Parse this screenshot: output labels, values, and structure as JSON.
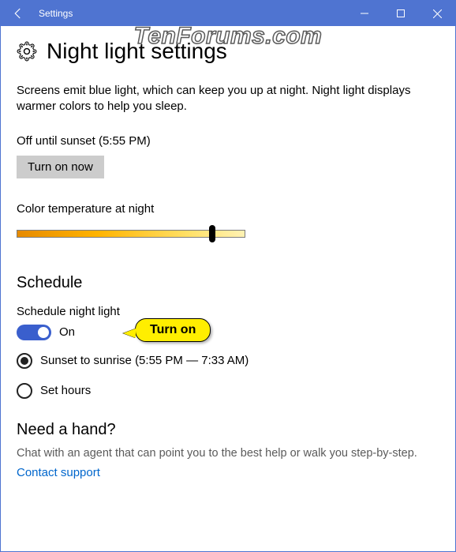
{
  "window": {
    "title": "Settings"
  },
  "page": {
    "heading": "Night light settings",
    "description": "Screens emit blue light, which can keep you up at night. Night light displays warmer colors to help you sleep.",
    "status": "Off until sunset (5:55 PM)",
    "turn_on_button": "Turn on now",
    "color_temp_label": "Color temperature at night"
  },
  "schedule": {
    "heading": "Schedule",
    "toggle_label": "Schedule night light",
    "toggle_state": "On",
    "option_sunset": "Sunset to sunrise (5:55 PM — 7:33 AM)",
    "option_set_hours": "Set hours"
  },
  "help": {
    "heading": "Need a hand?",
    "text": "Chat with an agent that can point you to the best help or walk you step-by-step.",
    "link": "Contact support"
  },
  "callout": {
    "text": "Turn on"
  },
  "watermark": "TenForums.com"
}
